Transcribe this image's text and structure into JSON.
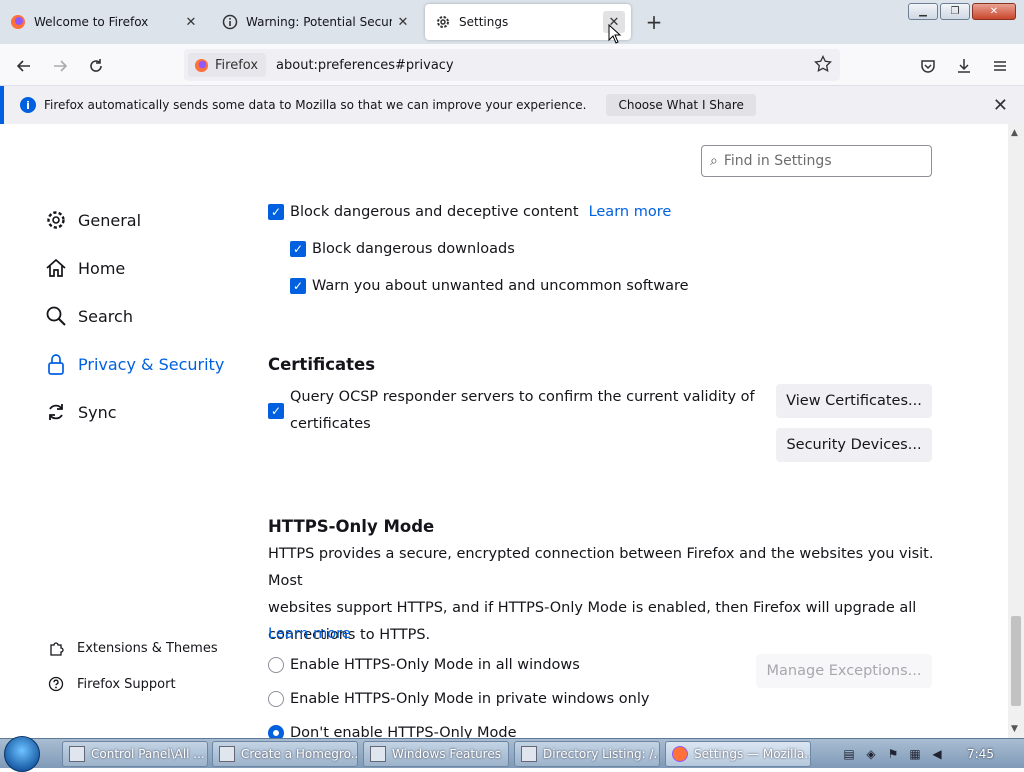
{
  "tabs": [
    {
      "title": "Welcome to Firefox",
      "icon": "firefox-icon"
    },
    {
      "title": "Warning: Potential Security R",
      "icon": "warning-icon"
    },
    {
      "title": "Settings",
      "icon": "gear-icon",
      "active": true
    }
  ],
  "navbar": {
    "identity_label": "Firefox",
    "url": "about:preferences#privacy"
  },
  "notification": {
    "message": "Firefox automatically sends some data to Mozilla so that we can improve your experience.",
    "button": "Choose What I Share"
  },
  "search": {
    "placeholder": "Find in Settings"
  },
  "sidebar": {
    "items": [
      {
        "label": "General",
        "icon": "gear-icon"
      },
      {
        "label": "Home",
        "icon": "home-icon"
      },
      {
        "label": "Search",
        "icon": "search-icon"
      },
      {
        "label": "Privacy & Security",
        "icon": "lock-icon",
        "selected": true
      },
      {
        "label": "Sync",
        "icon": "sync-icon"
      }
    ],
    "footer": [
      {
        "label": "Extensions & Themes",
        "icon": "puzzle-icon"
      },
      {
        "label": "Firefox Support",
        "icon": "help-icon"
      }
    ]
  },
  "security": {
    "block_dangerous": "Block dangerous and deceptive content",
    "learn_more": "Learn more",
    "block_downloads": "Block dangerous downloads",
    "warn_unwanted": "Warn you about unwanted and uncommon software"
  },
  "certificates": {
    "heading": "Certificates",
    "ocsp_line1": "Query OCSP responder servers to confirm the current validity of",
    "ocsp_line2": "certificates",
    "view_button": "View Certificates...",
    "devices_button": "Security Devices..."
  },
  "https_only": {
    "heading": "HTTPS-Only Mode",
    "line1": "HTTPS provides a secure, encrypted connection between Firefox and the websites you visit. Most",
    "line2": "websites support HTTPS, and if HTTPS-Only Mode is enabled, then Firefox will upgrade all",
    "line3": "connections to HTTPS.",
    "learn_more": "Learn more",
    "option_all": "Enable HTTPS-Only Mode in all windows",
    "option_private": "Enable HTTPS-Only Mode in private windows only",
    "option_off": "Don't enable HTTPS-Only Mode",
    "manage_button": "Manage Exceptions..."
  },
  "taskbar": {
    "items": [
      "Control Panel\\All ...",
      "Create a Homegro...",
      "Windows Features",
      "Directory Listing: /...",
      "Settings — Mozilla..."
    ],
    "clock": "7:45"
  },
  "colors": {
    "accent": "#0060df",
    "link": "#0061e0"
  }
}
